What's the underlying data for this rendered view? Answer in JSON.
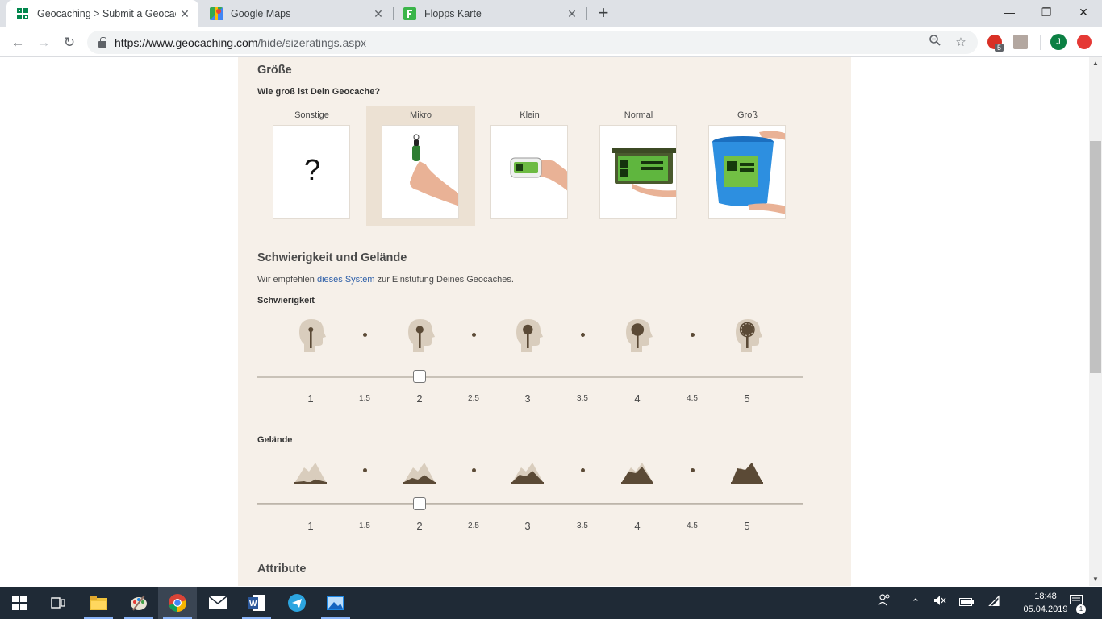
{
  "browser": {
    "tabs": [
      {
        "title": "Geocaching > Submit a Geocach",
        "active": true,
        "icon": "geocaching-icon"
      },
      {
        "title": "Google Maps",
        "active": false,
        "icon": "google-maps-icon"
      },
      {
        "title": "Flopps Karte",
        "active": false,
        "icon": "flopps-icon"
      }
    ],
    "url_host": "https://www.geocaching.com",
    "url_path": "/hide/sizeratings.aspx",
    "ext_badge": "5",
    "avatar_letter": "J"
  },
  "size_section": {
    "title": "Größe",
    "question": "Wie groß ist Dein Geocache?",
    "options": [
      "Sonstige",
      "Mikro",
      "Klein",
      "Normal",
      "Groß"
    ],
    "selected": "Mikro",
    "unknown_symbol": "?"
  },
  "rating_section": {
    "title": "Schwierigkeit und Gelände",
    "intro_before": "Wir empfehlen ",
    "intro_link": "dieses System",
    "intro_after": " zur Einstufung Deines Geocaches.",
    "difficulty": {
      "label": "Schwierigkeit",
      "value": 2
    },
    "terrain": {
      "label": "Gelände",
      "value": 2
    },
    "scale": [
      "1",
      "1.5",
      "2",
      "2.5",
      "3",
      "3.5",
      "4",
      "4.5",
      "5"
    ]
  },
  "attributes_section": {
    "title": "Attribute"
  },
  "taskbar": {
    "time": "18:48",
    "date": "05.04.2019",
    "notifications": "1"
  },
  "colors": {
    "content_bg": "#f6f0e9",
    "selected_bg": "#ece1d3",
    "icon_brown": "#5b4a36",
    "link": "#2c5ea8"
  }
}
